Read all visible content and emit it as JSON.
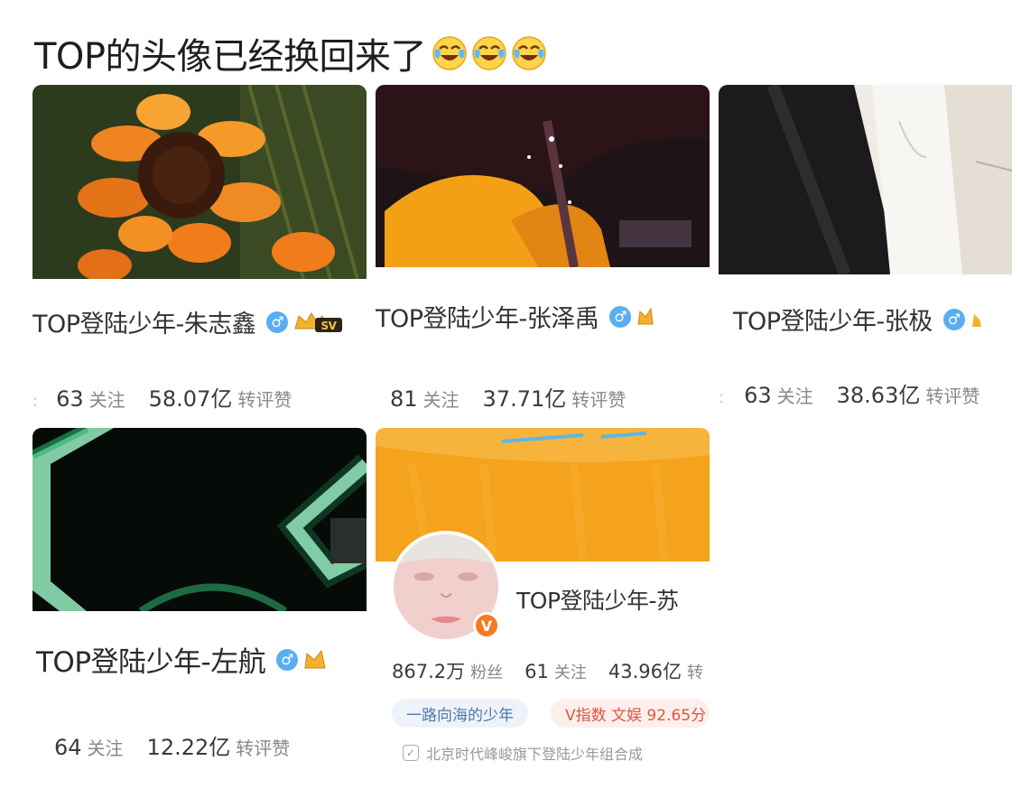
{
  "post": {
    "title": "TOP的头像已经换回来了",
    "emoji_icons": [
      "laugh-cry-icon",
      "laugh-cry-icon",
      "laugh-cry-icon"
    ]
  },
  "cards": [
    {
      "name": "TOP登陆少年-朱志鑫",
      "badge": "SV",
      "prefix": "",
      "following": "63",
      "following_label": "关注",
      "interactions": "58.07亿",
      "interactions_label": "转评赞",
      "banner": "sunflower-image"
    },
    {
      "name": "TOP登陆少年-张泽禹",
      "prefix": "",
      "following": "81",
      "following_label": "关注",
      "interactions": "37.71亿",
      "interactions_label": "转评赞",
      "banner": "dark-orange-image"
    },
    {
      "name": "TOP登陆少年-张极",
      "prefix": "",
      "following": "63",
      "following_label": "关注",
      "interactions": "38.63亿",
      "interactions_label": "转评赞",
      "banner": "shirt-image"
    },
    {
      "name": "TOP登陆少年-左航",
      "following": "64",
      "following_label": "关注",
      "interactions": "12.22亿",
      "interactions_label": "转评赞",
      "banner": "neon-green-image"
    },
    {
      "name": "TOP登陆少年-苏",
      "followers": "867.2万",
      "followers_label": "粉丝",
      "following": "61",
      "following_label": "关注",
      "interactions": "43.96亿",
      "interactions_label": "转",
      "tag_bio": "一路向海的少年",
      "tag_index": "V指数 文娱 92.65分",
      "description": "北京时代峰峻旗下登陆少年组合成",
      "verified": "V",
      "banner": "orange-banner-image"
    }
  ],
  "colors": {
    "gender_badge": "#5aaef0",
    "verified_badge": "#f57b20",
    "banner_orange": "#f5a21c"
  }
}
